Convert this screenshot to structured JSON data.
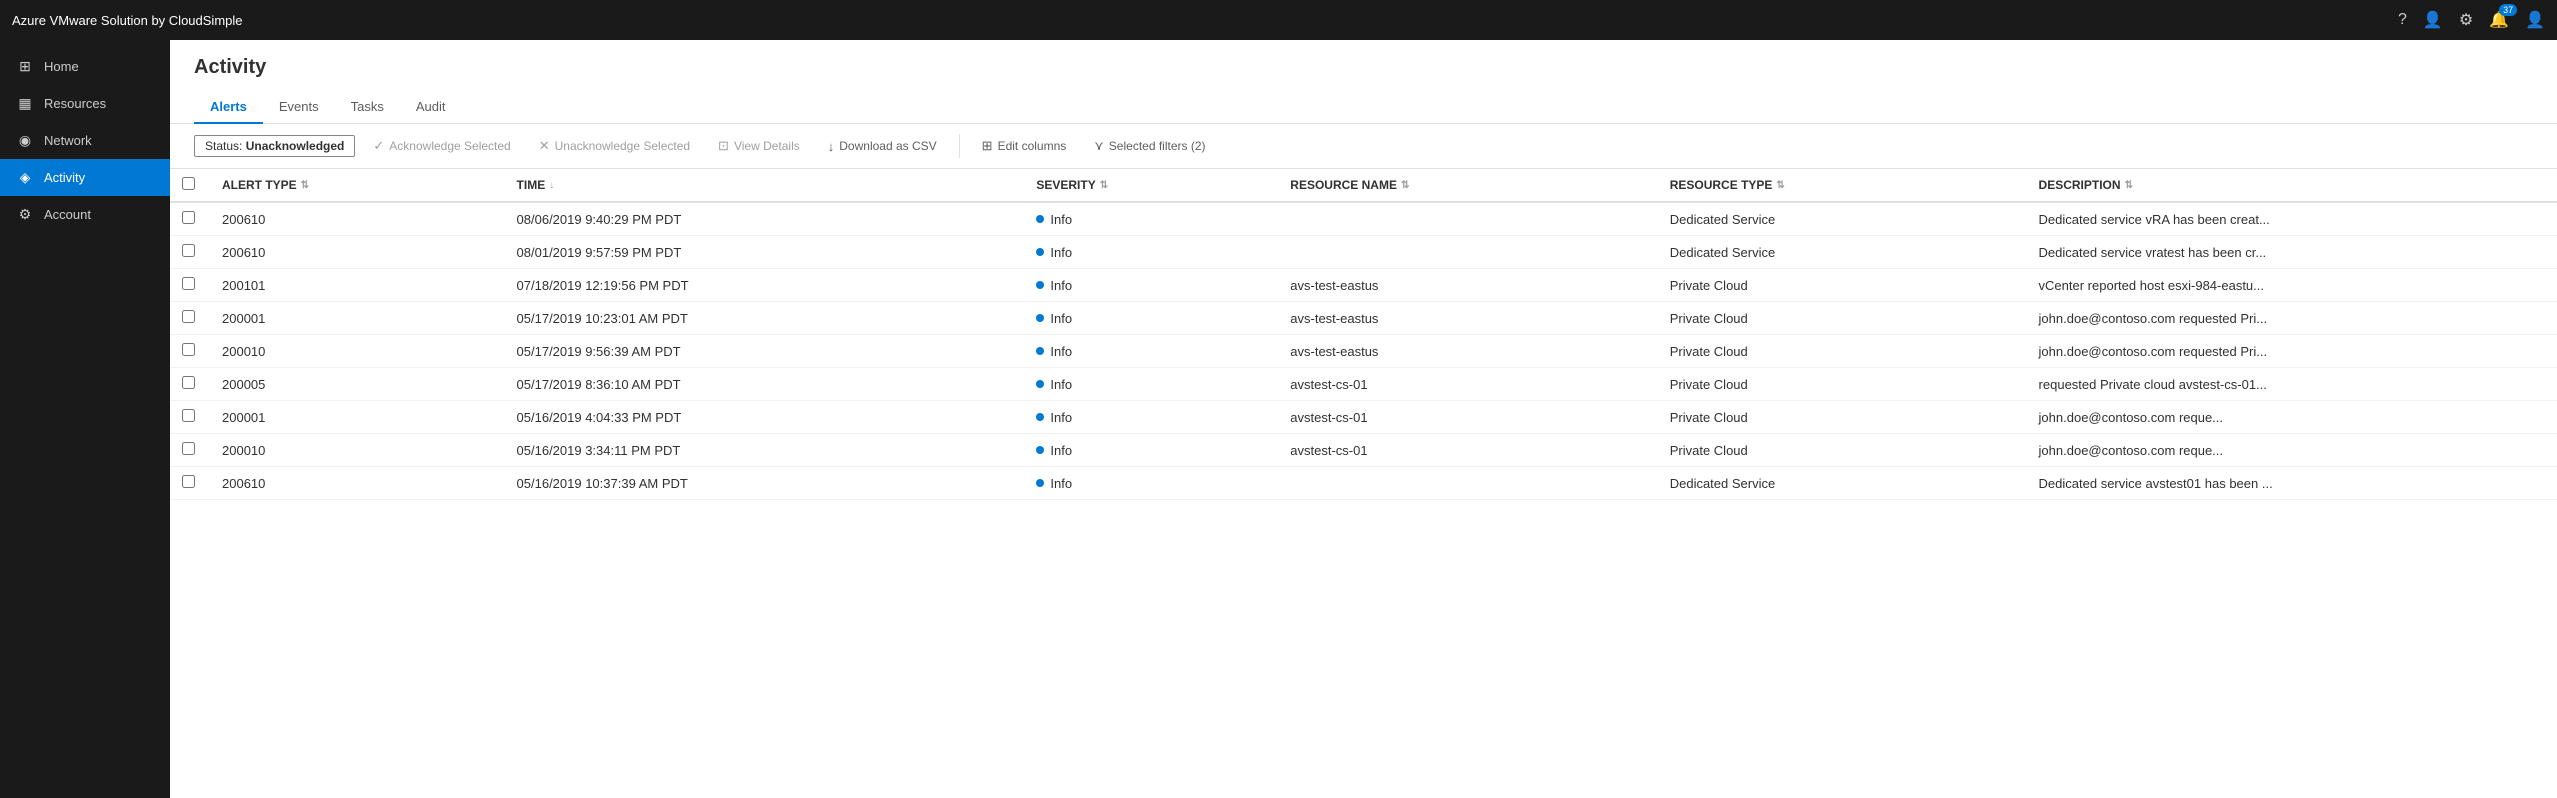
{
  "app": {
    "title": "Azure VMware Solution by CloudSimple"
  },
  "topbar": {
    "title": "Azure VMware Solution by CloudSimple",
    "notification_count": "37"
  },
  "sidebar": {
    "items": [
      {
        "id": "home",
        "label": "Home",
        "icon": "⊞",
        "active": false
      },
      {
        "id": "resources",
        "label": "Resources",
        "icon": "▦",
        "active": false
      },
      {
        "id": "network",
        "label": "Network",
        "icon": "◉",
        "active": false
      },
      {
        "id": "activity",
        "label": "Activity",
        "icon": "◈",
        "active": true
      },
      {
        "id": "account",
        "label": "Account",
        "icon": "⚙",
        "active": false
      }
    ]
  },
  "page": {
    "title": "Activity"
  },
  "tabs": [
    {
      "id": "alerts",
      "label": "Alerts",
      "active": true
    },
    {
      "id": "events",
      "label": "Events",
      "active": false
    },
    {
      "id": "tasks",
      "label": "Tasks",
      "active": false
    },
    {
      "id": "audit",
      "label": "Audit",
      "active": false
    }
  ],
  "toolbar": {
    "filter_label": "Status:",
    "filter_value": "Unacknowledged",
    "acknowledge_btn": "Acknowledge Selected",
    "unacknowledge_btn": "Unacknowledge Selected",
    "view_details_btn": "View Details",
    "download_btn": "Download as CSV",
    "edit_columns_btn": "Edit columns",
    "selected_filters_btn": "Selected filters (2)"
  },
  "table": {
    "columns": [
      {
        "id": "alert_type",
        "label": "ALERT TYPE"
      },
      {
        "id": "time",
        "label": "TIME"
      },
      {
        "id": "severity",
        "label": "SEVERITY"
      },
      {
        "id": "resource_name",
        "label": "RESOURCE NAME"
      },
      {
        "id": "resource_type",
        "label": "RESOURCE TYPE"
      },
      {
        "id": "description",
        "label": "DESCRIPTION"
      }
    ],
    "rows": [
      {
        "alert_type": "200610",
        "time": "08/06/2019 9:40:29 PM PDT",
        "severity": "Info",
        "resource_name": "",
        "resource_type": "Dedicated Service",
        "description": "Dedicated service vRA has been creat..."
      },
      {
        "alert_type": "200610",
        "time": "08/01/2019 9:57:59 PM PDT",
        "severity": "Info",
        "resource_name": "",
        "resource_type": "Dedicated Service",
        "description": "Dedicated service vratest has been cr..."
      },
      {
        "alert_type": "200101",
        "time": "07/18/2019 12:19:56 PM PDT",
        "severity": "Info",
        "resource_name": "avs-test-eastus",
        "resource_type": "Private Cloud",
        "description": "vCenter reported host esxi-984-eastu..."
      },
      {
        "alert_type": "200001",
        "time": "05/17/2019 10:23:01 AM PDT",
        "severity": "Info",
        "resource_name": "avs-test-eastus",
        "resource_type": "Private Cloud",
        "description": "john.doe@contoso.com requested Pri..."
      },
      {
        "alert_type": "200010",
        "time": "05/17/2019 9:56:39 AM PDT",
        "severity": "Info",
        "resource_name": "avs-test-eastus",
        "resource_type": "Private Cloud",
        "description": "john.doe@contoso.com requested Pri..."
      },
      {
        "alert_type": "200005",
        "time": "05/17/2019 8:36:10 AM PDT",
        "severity": "Info",
        "resource_name": "avstest-cs-01",
        "resource_type": "Private Cloud",
        "description": "requested Private cloud avstest-cs-01..."
      },
      {
        "alert_type": "200001",
        "time": "05/16/2019 4:04:33 PM PDT",
        "severity": "Info",
        "resource_name": "avstest-cs-01",
        "resource_type": "Private Cloud",
        "description": "john.doe@contoso.com  reque..."
      },
      {
        "alert_type": "200010",
        "time": "05/16/2019 3:34:11 PM PDT",
        "severity": "Info",
        "resource_name": "avstest-cs-01",
        "resource_type": "Private Cloud",
        "description": "john.doe@contoso.com  reque..."
      },
      {
        "alert_type": "200610",
        "time": "05/16/2019 10:37:39 AM PDT",
        "severity": "Info",
        "resource_name": "",
        "resource_type": "Dedicated Service",
        "description": "Dedicated service avstest01 has been ..."
      }
    ]
  }
}
